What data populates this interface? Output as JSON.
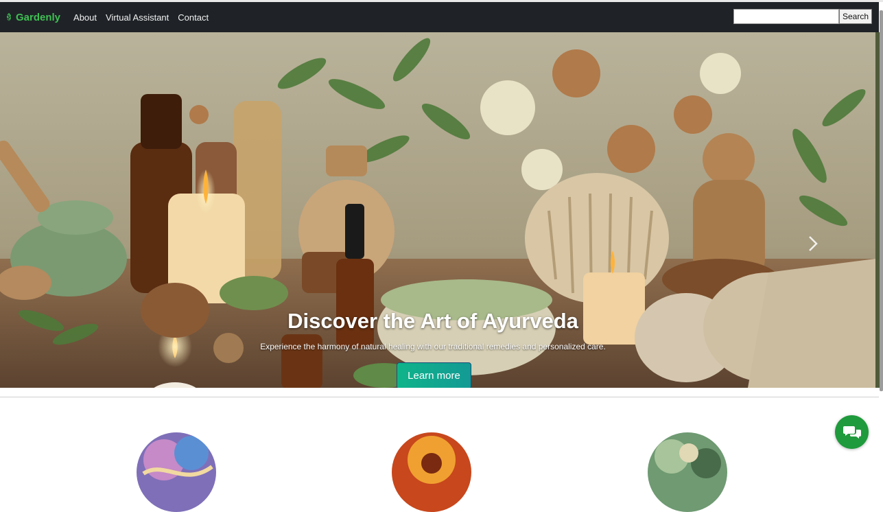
{
  "navbar": {
    "brand": "Gardenly",
    "links": [
      "About",
      "Virtual Assistant",
      "Contact"
    ],
    "search_placeholder": "",
    "search_button": "Search"
  },
  "hero": {
    "title": "Discover the Art of Ayurveda",
    "subtitle": "Experience the harmony of natural healing with our traditional remedies and personalized care.",
    "cta": "Learn more",
    "active_slide": 2,
    "slide_count": 3
  },
  "colors": {
    "navbar_bg": "#1f2327",
    "brand_green": "#3fbf54",
    "cta_teal": "#0fb48a",
    "chat_green": "#1f9a3c"
  },
  "icons": {
    "brand": "leaf-icon",
    "chat": "chat-bubbles-icon",
    "carousel_next": "chevron-right-icon"
  }
}
